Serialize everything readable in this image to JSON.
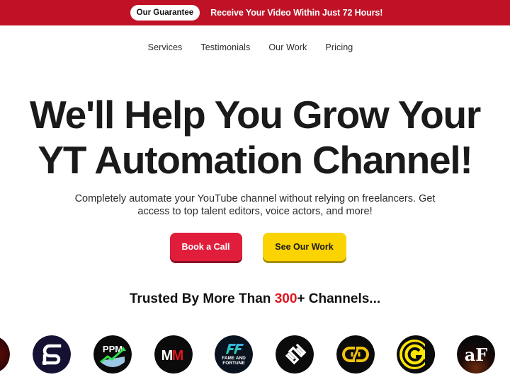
{
  "topbar": {
    "badge": "Our Guarantee",
    "message": "Receive Your Video Within Just 72 Hours!"
  },
  "nav": {
    "items": [
      {
        "label": "Services"
      },
      {
        "label": "Testimonials"
      },
      {
        "label": "Our Work"
      },
      {
        "label": "Pricing"
      }
    ]
  },
  "hero": {
    "title_line1": "We'll Help You Grow Your",
    "title_line2": "YT Automation Channel!",
    "subtitle_line1": "Completely automate your YouTube channel without relying on freelancers. Get",
    "subtitle_line2": "access to top talent editors, voice actors, and more!",
    "primary_cta": "Book a Call",
    "secondary_cta": "See Our Work"
  },
  "trusted": {
    "prefix": "Trusted By More Than ",
    "count": "300",
    "suffix": "+ Channels..."
  },
  "logos": [
    {
      "name": "channel-logo-partial",
      "text": ""
    },
    {
      "name": "channel-logo-sp",
      "text": ""
    },
    {
      "name": "channel-logo-ppm",
      "text": "PPM"
    },
    {
      "name": "channel-logo-mm",
      "text": "MM"
    },
    {
      "name": "channel-logo-fame-and-fortune",
      "text": "FAME AND FORTUNE"
    },
    {
      "name": "channel-logo-s-stripes",
      "text": ""
    },
    {
      "name": "channel-logo-gd",
      "text": ""
    },
    {
      "name": "channel-logo-cg",
      "text": ""
    },
    {
      "name": "channel-logo-af",
      "text": "aF"
    }
  ],
  "colors": {
    "brand_red": "#c01226",
    "button_red": "#e01e3c",
    "button_yellow": "#fad300",
    "accent_count": "#e0141e"
  }
}
